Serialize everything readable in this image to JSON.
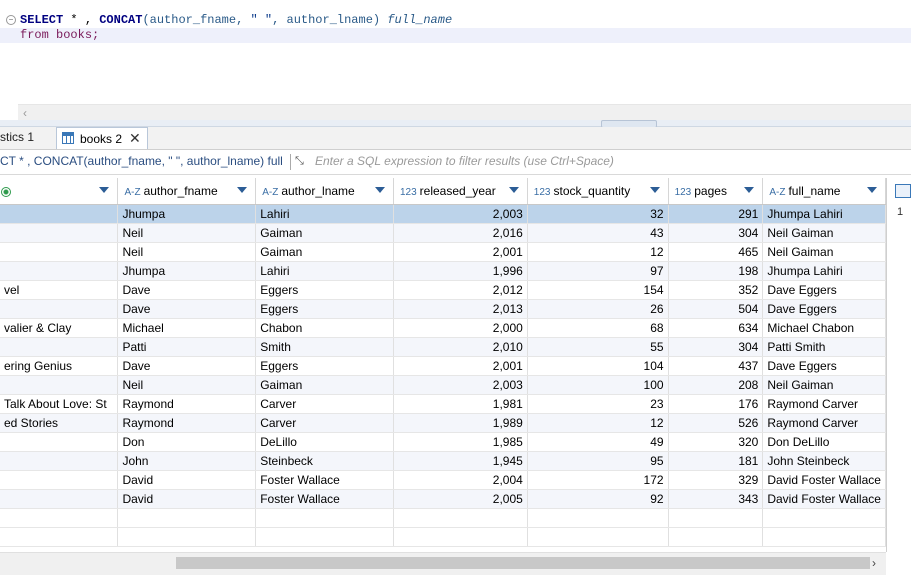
{
  "editor": {
    "line1": {
      "kw1": "SELECT",
      "rest1": " * , ",
      "fn": "CONCAT",
      "open": "(",
      "arg1": "author_fname",
      "comma1": ", ",
      "str": "\" \"",
      "comma2": ", ",
      "arg2": "author_lname",
      "close": ") ",
      "alias": "full_name"
    },
    "line2": {
      "kw": "from",
      "table": " books;"
    }
  },
  "tabs": [
    {
      "label": "stics 1"
    },
    {
      "label": "books 2"
    }
  ],
  "filter": {
    "query": "CT * , CONCAT(author_fname, \" \", author_lname) full",
    "placeholder": "Enter a SQL expression to filter results (use Ctrl+Space)"
  },
  "columns": [
    {
      "type": "",
      "name": ""
    },
    {
      "type": "A-Z",
      "name": "author_fname"
    },
    {
      "type": "A-Z",
      "name": "author_lname"
    },
    {
      "type": "123",
      "name": "released_year"
    },
    {
      "type": "123",
      "name": "stock_quantity"
    },
    {
      "type": "123",
      "name": "pages"
    },
    {
      "type": "A-Z",
      "name": "full_name"
    }
  ],
  "rows": [
    [
      "",
      "Jhumpa",
      "Lahiri",
      "2,003",
      "32",
      "291",
      "Jhumpa Lahiri"
    ],
    [
      "",
      "Neil",
      "Gaiman",
      "2,016",
      "43",
      "304",
      "Neil Gaiman"
    ],
    [
      "",
      "Neil",
      "Gaiman",
      "2,001",
      "12",
      "465",
      "Neil Gaiman"
    ],
    [
      "",
      "Jhumpa",
      "Lahiri",
      "1,996",
      "97",
      "198",
      "Jhumpa Lahiri"
    ],
    [
      "vel",
      "Dave",
      "Eggers",
      "2,012",
      "154",
      "352",
      "Dave Eggers"
    ],
    [
      "",
      "Dave",
      "Eggers",
      "2,013",
      "26",
      "504",
      "Dave Eggers"
    ],
    [
      "valier & Clay",
      "Michael",
      "Chabon",
      "2,000",
      "68",
      "634",
      "Michael Chabon"
    ],
    [
      "",
      "Patti",
      "Smith",
      "2,010",
      "55",
      "304",
      "Patti Smith"
    ],
    [
      "ering Genius",
      "Dave",
      "Eggers",
      "2,001",
      "104",
      "437",
      "Dave Eggers"
    ],
    [
      "",
      "Neil",
      "Gaiman",
      "2,003",
      "100",
      "208",
      "Neil Gaiman"
    ],
    [
      " Talk About Love: St",
      "Raymond",
      "Carver",
      "1,981",
      "23",
      "176",
      "Raymond Carver"
    ],
    [
      "ed Stories",
      "Raymond",
      "Carver",
      "1,989",
      "12",
      "526",
      "Raymond Carver"
    ],
    [
      "",
      "Don",
      "DeLillo",
      "1,985",
      "49",
      "320",
      "Don DeLillo"
    ],
    [
      "",
      "John",
      "Steinbeck",
      "1,945",
      "95",
      "181",
      "John Steinbeck"
    ],
    [
      "",
      "David",
      "Foster Wallace",
      "2,004",
      "172",
      "329",
      "David Foster Wallace"
    ],
    [
      "",
      "David",
      "Foster Wallace",
      "2,005",
      "92",
      "343",
      "David Foster Wallace"
    ]
  ],
  "right_panel": {
    "record_number": "1"
  },
  "colors": {
    "selected_row": "#bcd3ea",
    "accent": "#2c5d96"
  }
}
